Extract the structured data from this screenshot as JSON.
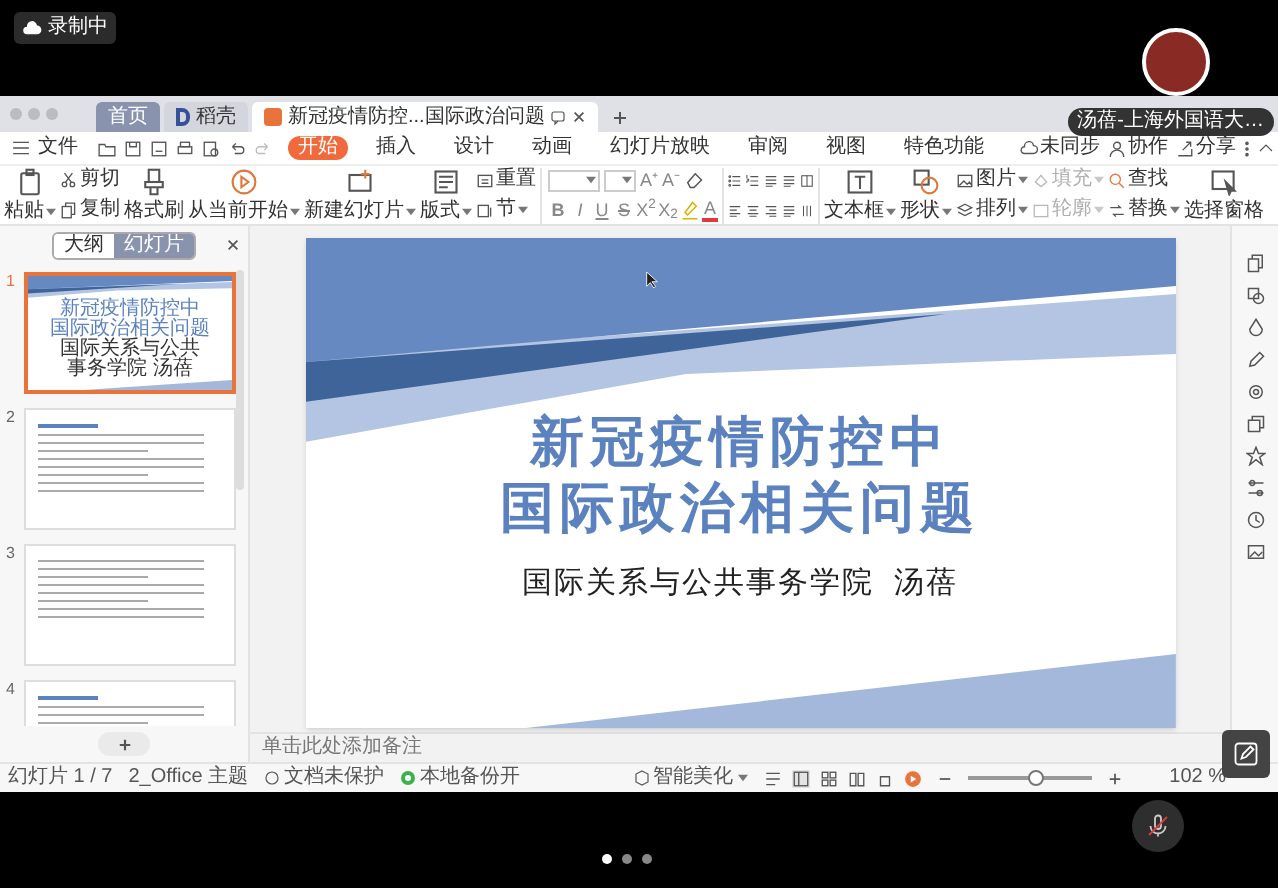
{
  "recording": {
    "label": "录制中"
  },
  "participant": {
    "name": "汤蓓-上海外国语大…"
  },
  "tabs": [
    {
      "label": "首页",
      "kind": "home",
      "selected": false
    },
    {
      "label": "稻壳",
      "kind": "docer",
      "selected": false
    },
    {
      "label": "新冠疫情防控...国际政治问题",
      "kind": "document",
      "selected": true
    }
  ],
  "menu": {
    "file": "文件",
    "items": [
      {
        "label": "开始",
        "selected": true
      },
      {
        "label": "插入",
        "selected": false
      },
      {
        "label": "设计",
        "selected": false
      },
      {
        "label": "动画",
        "selected": false
      },
      {
        "label": "幻灯片放映",
        "selected": false
      },
      {
        "label": "审阅",
        "selected": false
      },
      {
        "label": "视图",
        "selected": false
      },
      {
        "label": "特色功能",
        "selected": false
      }
    ],
    "right": [
      {
        "label": "未同步"
      },
      {
        "label": "协作"
      },
      {
        "label": "分享"
      }
    ]
  },
  "toolbar": [
    {
      "kind": "big",
      "label": "粘贴",
      "dropdown": true
    },
    {
      "kind": "pair",
      "items": [
        {
          "label": "剪切",
          "dropdown": false,
          "disabled": false
        },
        {
          "label": "复制",
          "dropdown": false,
          "disabled": false
        }
      ]
    },
    {
      "kind": "big",
      "label": "格式刷",
      "dropdown": false
    },
    {
      "kind": "big",
      "label": "从当前开始",
      "dropdown": true
    },
    {
      "kind": "big",
      "label": "新建幻灯片",
      "dropdown": true
    },
    {
      "kind": "big",
      "label": "版式",
      "dropdown": true
    },
    {
      "kind": "pair",
      "items": [
        {
          "label": "重置",
          "dropdown": false,
          "disabled": false
        },
        {
          "label": "节",
          "dropdown": true,
          "disabled": false
        }
      ]
    },
    {
      "kind": "font",
      "size_buttons": [
        "A⁺",
        "A⁻"
      ],
      "buttons": [
        "B",
        "I",
        "U",
        "S",
        "X$^{2}$",
        "X$_{2}$"
      ],
      "color_button": "A"
    },
    {
      "kind": "paragraph"
    },
    {
      "kind": "big",
      "label": "文本框",
      "dropdown": true
    },
    {
      "kind": "big",
      "label": "形状",
      "dropdown": true
    },
    {
      "kind": "pair",
      "items": [
        {
          "label": "图片",
          "dropdown": true,
          "disabled": false
        },
        {
          "label": "排列",
          "dropdown": true,
          "disabled": false
        }
      ]
    },
    {
      "kind": "pair",
      "items": [
        {
          "label": "填充",
          "dropdown": true,
          "disabled": true
        },
        {
          "label": "轮廓",
          "dropdown": true,
          "disabled": true
        }
      ]
    },
    {
      "kind": "pair",
      "items": [
        {
          "label": "查找",
          "dropdown": false,
          "disabled": false
        },
        {
          "label": "替换",
          "dropdown": true,
          "disabled": false
        }
      ]
    },
    {
      "kind": "big",
      "label": "选择窗格",
      "dropdown": false
    }
  ],
  "panel": {
    "tabs": [
      {
        "label": "大纲",
        "selected": false
      },
      {
        "label": "幻灯片",
        "selected": true
      }
    ],
    "slides": [
      {
        "number": "1",
        "selected": true,
        "kind": "title",
        "title": [
          "新冠疫情防控中",
          "国际政治相关问题"
        ],
        "subtitle": "国际关系与公共事务学院 汤蓓"
      },
      {
        "number": "2",
        "selected": false,
        "kind": "heading"
      },
      {
        "number": "3",
        "selected": false,
        "kind": "text"
      },
      {
        "number": "4",
        "selected": false,
        "kind": "heading"
      }
    ]
  },
  "slide": {
    "title": [
      "新冠疫情防控中",
      "国际政治相关问题"
    ],
    "subtitle": "国际关系与公共事务学院  汤蓓"
  },
  "notes": {
    "placeholder": "单击此处添加备注"
  },
  "status_bar": {
    "slide": "幻灯片 1 / 7",
    "theme": "2_Office 主题",
    "protection": "文档未保护",
    "backup": "本地备份开",
    "beautify": "智能美化",
    "zoom": {
      "level": 0.55,
      "value": "102 %"
    }
  },
  "page_dots": [
    {
      "selected": true
    },
    {
      "selected": false
    },
    {
      "selected": false
    }
  ]
}
